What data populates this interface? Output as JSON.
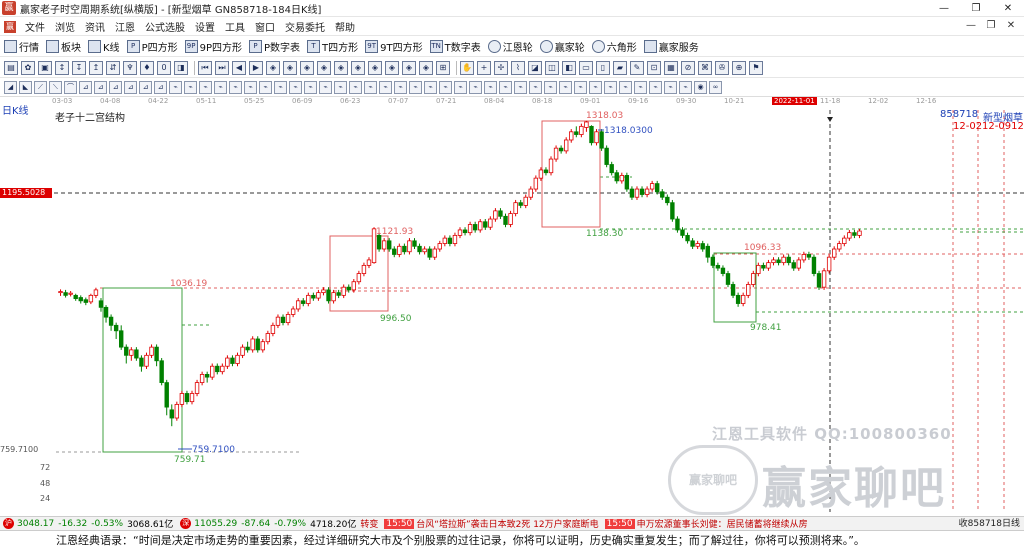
{
  "window": {
    "title": "赢家老子时空周期系统[纵横版] - [新型烟草  GN858718-184日K线]",
    "min": "—",
    "max": "❐",
    "close": "✕"
  },
  "menu": [
    "文件",
    "浏览",
    "资讯",
    "江恩",
    "公式选股",
    "设置",
    "工具",
    "窗口",
    "交易委托",
    "帮助"
  ],
  "menu_right": [
    "—",
    "❐",
    "✕"
  ],
  "toolbar1": [
    {
      "label": "行情",
      "icon": "grid-icon"
    },
    {
      "label": "板块",
      "icon": "blocks-icon"
    },
    {
      "label": "K线",
      "icon": "kline-icon"
    },
    {
      "label": "P四方形",
      "icon": "p-square-icon",
      "glyph": "P"
    },
    {
      "label": "9P四方形",
      "icon": "9p-square-icon",
      "glyph": "9P"
    },
    {
      "label": "P数字表",
      "icon": "p-table-icon",
      "glyph": "P"
    },
    {
      "label": "T四方形",
      "icon": "t-square-icon",
      "glyph": "T"
    },
    {
      "label": "9T四方形",
      "icon": "9t-square-icon",
      "glyph": "9T"
    },
    {
      "label": "T数字表",
      "icon": "t-table-icon",
      "glyph": "TN"
    },
    {
      "label": "江恩轮",
      "icon": "gann-wheel-icon",
      "round": true
    },
    {
      "label": "赢家轮",
      "icon": "winner-wheel-icon",
      "round": true
    },
    {
      "label": "六角形",
      "icon": "hexagon-icon",
      "round": true
    },
    {
      "label": "赢家服务",
      "icon": "service-icon"
    }
  ],
  "toolbar2_glyphs": [
    "▤",
    "✿",
    "▣",
    "↕",
    "↧",
    "↥",
    "⇵",
    "♆",
    "♦",
    "0",
    "◨",
    "|",
    "⏮",
    "⏭",
    "◀",
    "▶",
    "◈",
    "◈",
    "◈",
    "◈",
    "◈",
    "◈",
    "◈",
    "◈",
    "◈",
    "◈",
    "⊞",
    "|",
    "✋",
    "+",
    "✢",
    "⌇",
    "◪",
    "◫",
    "◧",
    "▭",
    "▯",
    "▰",
    "✎",
    "⊡",
    "▦",
    "⊘",
    "⌘",
    "✇",
    "⊕",
    "⚑"
  ],
  "toolbar3_glyphs": [
    "◢",
    "◣",
    "⟋",
    "⟍",
    "⌒",
    "⊿",
    "⊿",
    "⊿",
    "⊿",
    "⊿",
    "⊿",
    "⌁",
    "⌁",
    "⌁",
    "⌁",
    "⌁",
    "⌁",
    "⌁",
    "⌁",
    "⌁",
    "⌁",
    "⌁",
    "⌁",
    "⌁",
    "⌁",
    "⌁",
    "⌁",
    "⌁",
    "⌁",
    "⌁",
    "⌁",
    "⌁",
    "⌁",
    "⌁",
    "⌁",
    "⌁",
    "⌁",
    "⌁",
    "⌁",
    "⌁",
    "⌁",
    "⌁",
    "⌁",
    "⌁",
    "⌁",
    "⌁",
    "◉",
    "∞"
  ],
  "date_axis": [
    "03-03",
    "04-08",
    "04-22",
    "05-11",
    "05-25",
    "06-09",
    "06-23",
    "07-07",
    "07-21",
    "08-04",
    "08-18",
    "09-01",
    "09-16",
    "09-30",
    "10-21",
    "2022-11-01",
    "11-18",
    "12-02",
    "12-16"
  ],
  "period_label": "日K线",
  "chart_title": "老子十二宫结构",
  "code": "858718",
  "stock_name": "新型烟草",
  "date_marks": "12-0212-0912-16",
  "price_axis": [
    "759.7100",
    "72",
    "48",
    "24"
  ],
  "current_price": "1195.5028",
  "chart_data": {
    "type": "candlestick",
    "title": "老子十二宫结构",
    "ylim": [
      720,
      1340
    ],
    "candles": [
      [
        1005,
        1007,
        999,
        1011
      ],
      [
        1005,
        1000,
        996,
        1010
      ],
      [
        1002,
        1004,
        998,
        1008
      ],
      [
        1000,
        994,
        990,
        1003
      ],
      [
        996,
        990,
        985,
        1000
      ],
      [
        992,
        987,
        982,
        996
      ],
      [
        988,
        1000,
        984,
        1003
      ],
      [
        1000,
        1010,
        995,
        1014
      ],
      [
        990,
        978,
        970,
        995
      ],
      [
        978,
        960,
        950,
        982
      ],
      [
        960,
        945,
        935,
        965
      ],
      [
        945,
        935,
        920,
        950
      ],
      [
        935,
        905,
        900,
        945
      ],
      [
        905,
        890,
        875,
        910
      ],
      [
        890,
        900,
        880,
        905
      ],
      [
        900,
        885,
        880,
        905
      ],
      [
        885,
        870,
        860,
        890
      ],
      [
        870,
        890,
        865,
        895
      ],
      [
        890,
        905,
        885,
        910
      ],
      [
        905,
        880,
        870,
        910
      ],
      [
        880,
        840,
        835,
        885
      ],
      [
        840,
        795,
        780,
        845
      ],
      [
        790,
        775,
        760,
        800
      ],
      [
        775,
        800,
        770,
        805
      ],
      [
        800,
        820,
        795,
        825
      ],
      [
        820,
        805,
        800,
        825
      ],
      [
        805,
        820,
        800,
        825
      ],
      [
        820,
        840,
        815,
        845
      ],
      [
        840,
        855,
        835,
        860
      ],
      [
        855,
        850,
        840,
        860
      ],
      [
        850,
        870,
        845,
        875
      ],
      [
        870,
        860,
        855,
        875
      ],
      [
        860,
        870,
        855,
        875
      ],
      [
        870,
        885,
        865,
        890
      ],
      [
        885,
        875,
        870,
        890
      ],
      [
        875,
        890,
        870,
        895
      ],
      [
        890,
        905,
        885,
        910
      ],
      [
        905,
        900,
        895,
        915
      ],
      [
        900,
        920,
        895,
        925
      ],
      [
        920,
        900,
        895,
        925
      ],
      [
        900,
        915,
        895,
        920
      ],
      [
        915,
        930,
        910,
        935
      ],
      [
        930,
        945,
        925,
        950
      ],
      [
        945,
        960,
        940,
        965
      ],
      [
        960,
        950,
        945,
        965
      ],
      [
        950,
        965,
        945,
        970
      ],
      [
        965,
        975,
        960,
        980
      ],
      [
        975,
        990,
        970,
        995
      ],
      [
        990,
        985,
        980,
        995
      ],
      [
        985,
        1000,
        980,
        1005
      ],
      [
        1000,
        995,
        990,
        1005
      ],
      [
        995,
        1005,
        990,
        1010
      ],
      [
        1005,
        1010,
        1000,
        1015
      ],
      [
        1010,
        990,
        985,
        1015
      ],
      [
        990,
        1005,
        985,
        1010
      ],
      [
        1005,
        1000,
        995,
        1010
      ],
      [
        1000,
        1015,
        995,
        1020
      ],
      [
        1015,
        1010,
        1005,
        1020
      ],
      [
        1010,
        1025,
        1005,
        1030
      ],
      [
        1025,
        1040,
        1020,
        1045
      ],
      [
        1040,
        1055,
        1035,
        1060
      ],
      [
        1055,
        1065,
        1050,
        1070
      ],
      [
        1060,
        1122,
        1058,
        1125
      ],
      [
        1110,
        1085,
        1080,
        1115
      ],
      [
        1085,
        1100,
        1080,
        1105
      ],
      [
        1100,
        1085,
        1080,
        1105
      ],
      [
        1085,
        1075,
        1070,
        1090
      ],
      [
        1075,
        1090,
        1070,
        1095
      ],
      [
        1090,
        1080,
        1075,
        1095
      ],
      [
        1080,
        1100,
        1075,
        1105
      ],
      [
        1100,
        1090,
        1085,
        1105
      ],
      [
        1090,
        1080,
        1075,
        1095
      ],
      [
        1080,
        1085,
        1075,
        1090
      ],
      [
        1085,
        1070,
        1065,
        1090
      ],
      [
        1070,
        1085,
        1065,
        1090
      ],
      [
        1085,
        1095,
        1080,
        1100
      ],
      [
        1095,
        1105,
        1090,
        1110
      ],
      [
        1105,
        1095,
        1090,
        1110
      ],
      [
        1095,
        1110,
        1090,
        1115
      ],
      [
        1110,
        1120,
        1105,
        1125
      ],
      [
        1120,
        1115,
        1110,
        1125
      ],
      [
        1115,
        1130,
        1110,
        1135
      ],
      [
        1130,
        1120,
        1115,
        1135
      ],
      [
        1120,
        1135,
        1115,
        1140
      ],
      [
        1135,
        1125,
        1120,
        1140
      ],
      [
        1125,
        1140,
        1120,
        1145
      ],
      [
        1140,
        1155,
        1135,
        1160
      ],
      [
        1155,
        1145,
        1140,
        1160
      ],
      [
        1145,
        1130,
        1125,
        1150
      ],
      [
        1130,
        1150,
        1125,
        1155
      ],
      [
        1150,
        1170,
        1145,
        1175
      ],
      [
        1170,
        1165,
        1160,
        1175
      ],
      [
        1165,
        1180,
        1160,
        1185
      ],
      [
        1180,
        1195,
        1175,
        1200
      ],
      [
        1195,
        1215,
        1190,
        1220
      ],
      [
        1215,
        1230,
        1210,
        1235
      ],
      [
        1230,
        1225,
        1220,
        1235
      ],
      [
        1225,
        1250,
        1220,
        1255
      ],
      [
        1250,
        1270,
        1245,
        1275
      ],
      [
        1270,
        1265,
        1260,
        1275
      ],
      [
        1265,
        1285,
        1260,
        1290
      ],
      [
        1285,
        1300,
        1280,
        1305
      ],
      [
        1300,
        1295,
        1290,
        1310
      ],
      [
        1295,
        1310,
        1290,
        1315
      ],
      [
        1308,
        1318,
        1300,
        1320
      ],
      [
        1310,
        1280,
        1275,
        1312
      ],
      [
        1280,
        1300,
        1275,
        1305
      ],
      [
        1300,
        1270,
        1265,
        1305
      ],
      [
        1270,
        1240,
        1235,
        1275
      ],
      [
        1240,
        1225,
        1220,
        1245
      ],
      [
        1225,
        1210,
        1205,
        1230
      ],
      [
        1210,
        1220,
        1205,
        1225
      ],
      [
        1220,
        1195,
        1190,
        1225
      ],
      [
        1195,
        1180,
        1175,
        1200
      ],
      [
        1180,
        1195,
        1175,
        1200
      ],
      [
        1195,
        1185,
        1180,
        1200
      ],
      [
        1185,
        1195,
        1180,
        1200
      ],
      [
        1195,
        1205,
        1190,
        1210
      ],
      [
        1205,
        1190,
        1185,
        1210
      ],
      [
        1190,
        1180,
        1175,
        1195
      ],
      [
        1180,
        1170,
        1165,
        1185
      ],
      [
        1170,
        1140,
        1135,
        1175
      ],
      [
        1140,
        1120,
        1115,
        1145
      ],
      [
        1120,
        1110,
        1105,
        1125
      ],
      [
        1110,
        1100,
        1095,
        1115
      ],
      [
        1100,
        1090,
        1085,
        1105
      ],
      [
        1090,
        1095,
        1085,
        1100
      ],
      [
        1095,
        1085,
        1080,
        1100
      ],
      [
        1090,
        1070,
        1060,
        1095
      ],
      [
        1070,
        1055,
        1050,
        1075
      ],
      [
        1055,
        1050,
        1045,
        1060
      ],
      [
        1050,
        1040,
        1035,
        1055
      ],
      [
        1040,
        1020,
        1015,
        1045
      ],
      [
        1020,
        1000,
        995,
        1025
      ],
      [
        1000,
        985,
        979,
        1005
      ],
      [
        985,
        1000,
        980,
        1005
      ],
      [
        1000,
        1020,
        995,
        1025
      ],
      [
        1020,
        1040,
        1015,
        1045
      ],
      [
        1040,
        1055,
        1035,
        1060
      ],
      [
        1055,
        1050,
        1045,
        1060
      ],
      [
        1050,
        1060,
        1045,
        1065
      ],
      [
        1060,
        1065,
        1055,
        1070
      ],
      [
        1065,
        1060,
        1055,
        1070
      ],
      [
        1060,
        1070,
        1055,
        1075
      ],
      [
        1070,
        1060,
        1055,
        1075
      ],
      [
        1060,
        1050,
        1045,
        1065
      ],
      [
        1050,
        1065,
        1045,
        1070
      ],
      [
        1065,
        1075,
        1060,
        1080
      ],
      [
        1075,
        1070,
        1065,
        1080
      ],
      [
        1070,
        1040,
        1035,
        1075
      ],
      [
        1040,
        1015,
        1010,
        1045
      ],
      [
        1015,
        1045,
        1010,
        1050
      ],
      [
        1045,
        1070,
        1040,
        1075
      ],
      [
        1070,
        1085,
        1065,
        1090
      ],
      [
        1085,
        1095,
        1080,
        1100
      ],
      [
        1095,
        1105,
        1090,
        1110
      ],
      [
        1105,
        1115,
        1100,
        1120
      ],
      [
        1115,
        1110,
        1105,
        1120
      ],
      [
        1110,
        1118,
        1105,
        1122
      ]
    ],
    "annotations": [
      "1036.19",
      "759.71",
      "759.7100",
      "1121.93",
      "996.50",
      "1318.03",
      "1318.0300",
      "1138.30",
      "1096.33",
      "978.41"
    ]
  },
  "watermark": {
    "line1": "江恩工具软件  QQ:100800360",
    "logo": "赢家聊吧",
    "big": "赢家聊吧"
  },
  "ticker": {
    "badge1": "沪",
    "sh": "3048.17",
    "sh_chg": "-16.32",
    "sh_pct": "-0.53%",
    "sh_amt": "3068.61亿",
    "badge2": "深",
    "sz": "11055.29",
    "sz_chg": "-87.64",
    "sz_pct": "-0.79%",
    "sz_amt": "4718.20亿",
    "n0": "转变",
    "t1": "15:50",
    "n1": "台风“塔拉斯”袭击日本致2死 12万户家庭断电",
    "t2": "15:50",
    "n2": "申万宏源董事长刘健：居民储蓄将继续从房",
    "end": "收858718日线"
  },
  "quote": "江恩经典语录：“时间是决定市场走势的重要因素，经过详细研究大市及个别股票的过往记录，你将可以证明，历史确实重复发生；而了解过往，你将可以预测将来。”。"
}
